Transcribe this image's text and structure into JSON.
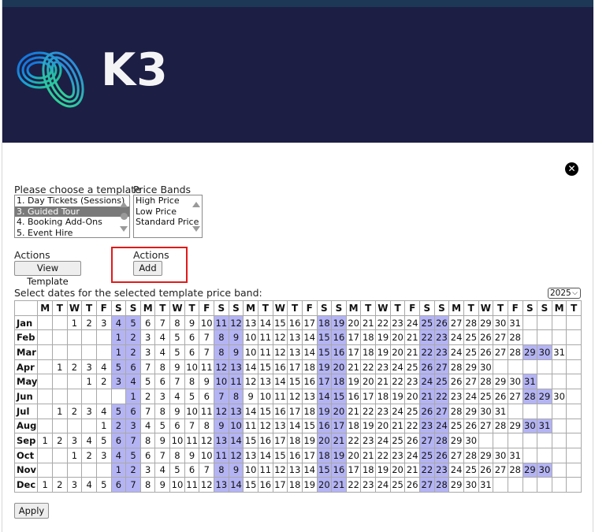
{
  "header": {
    "logo_text": "K3",
    "brand_color": "#1d1e44",
    "topbar_color": "#1d3857"
  },
  "close_icon": "close-circle-icon",
  "template_label": "Please choose a template",
  "templates": [
    {
      "label": "1. Day Tickets (Sessions)",
      "selected": false
    },
    {
      "label": "3. Guided Tour",
      "selected": true
    },
    {
      "label": "4. Booking Add-Ons",
      "selected": false
    },
    {
      "label": "5. Event Hire",
      "selected": false
    }
  ],
  "price_bands_label": "Price Bands",
  "price_bands": [
    {
      "label": "High Price"
    },
    {
      "label": "Low Price"
    },
    {
      "label": "Standard Price"
    }
  ],
  "actions_left": {
    "label": "Actions",
    "button": "View Template"
  },
  "actions_right": {
    "label": "Actions",
    "button": "Add"
  },
  "select_dates_label": "Select dates for the selected template price band:",
  "year": "2025",
  "weekday_headers": [
    "M",
    "T",
    "W",
    "T",
    "F",
    "S",
    "S",
    "M",
    "T",
    "W",
    "T",
    "F",
    "S",
    "S",
    "M",
    "T",
    "W",
    "T",
    "F",
    "S",
    "S",
    "M",
    "T",
    "W",
    "T",
    "F",
    "S",
    "S",
    "M",
    "T",
    "W",
    "T",
    "F",
    "S",
    "S",
    "M",
    "T"
  ],
  "weekend_color": "#b4b4f4",
  "months": [
    {
      "name": "Jan",
      "offset": 2,
      "days": 31
    },
    {
      "name": "Feb",
      "offset": 5,
      "days": 28
    },
    {
      "name": "Mar",
      "offset": 5,
      "days": 31
    },
    {
      "name": "Apr",
      "offset": 1,
      "days": 30
    },
    {
      "name": "May",
      "offset": 3,
      "days": 31
    },
    {
      "name": "Jun",
      "offset": 6,
      "days": 30
    },
    {
      "name": "Jul",
      "offset": 1,
      "days": 31
    },
    {
      "name": "Aug",
      "offset": 4,
      "days": 31
    },
    {
      "name": "Sep",
      "offset": 0,
      "days": 30
    },
    {
      "name": "Oct",
      "offset": 2,
      "days": 31
    },
    {
      "name": "Nov",
      "offset": 5,
      "days": 30
    },
    {
      "name": "Dec",
      "offset": 0,
      "days": 31
    }
  ],
  "apply_button": "Apply"
}
